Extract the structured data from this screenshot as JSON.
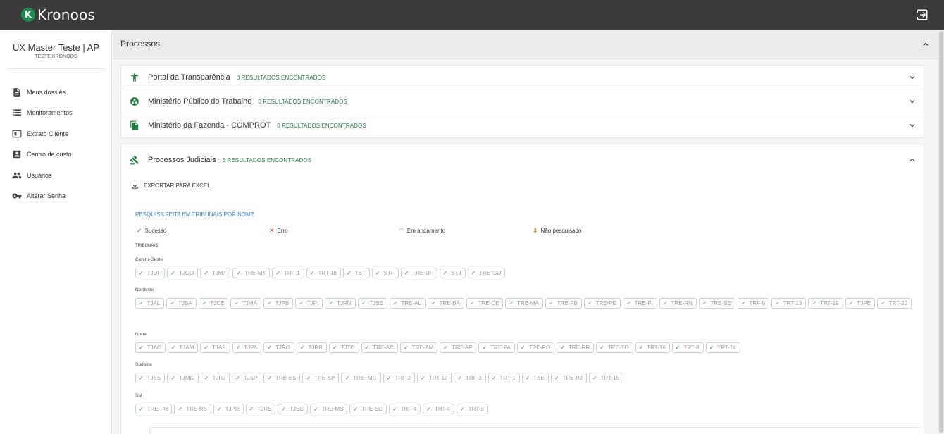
{
  "app": {
    "logo_letter": "K",
    "logo_text": "Kronoos",
    "brand_color": "#1c8a48"
  },
  "user": {
    "name": "UX Master Teste | AP",
    "subtitle": "TESTE KRONOOS"
  },
  "sidebar": {
    "items": [
      {
        "label": "Meus dossiês",
        "icon": "document-icon"
      },
      {
        "label": "Monitoramentos",
        "icon": "storage-icon"
      },
      {
        "label": "Extrato Cliente",
        "icon": "statement-icon"
      },
      {
        "label": "Centro de custo",
        "icon": "contact-card-icon"
      },
      {
        "label": "Usuários",
        "icon": "people-icon"
      },
      {
        "label": "Alterar Senha",
        "icon": "key-icon"
      }
    ]
  },
  "section": {
    "title": "Processos"
  },
  "panels": [
    {
      "name": "Portal da Transparência",
      "count": "0 RESULTADOS ENCONTRADOS",
      "icon": "accessibility-icon"
    },
    {
      "name": "Ministério Público do Trabalho",
      "count": "0 RESULTADOS ENCONTRADOS",
      "icon": "group-circle-icon"
    },
    {
      "name": "Ministério da Fazenda - COMPROT",
      "count": "0 RESULTADOS ENCONTRADOS",
      "icon": "copy-files-icon"
    }
  ],
  "judicial": {
    "name": "Processos Judiciais",
    "count": "5 RESULTADOS ENCONTRADOS",
    "icon": "gavel-icon",
    "export_label": "EXPORTAR PARA EXCEL",
    "search_label": "PESQUISA FEITA EM TRIBUNAIS POR NOME",
    "legend": {
      "success": "Sucesso",
      "error": "Erro",
      "pending": "Em andamento",
      "not_searched": "Não pesquisado"
    },
    "tribunais_label": "TRIBUNAIS:",
    "regions": [
      {
        "name": "Centro-Oeste",
        "courts": [
          "TJDF",
          "TJGO",
          "TJMT",
          "TRE-MT",
          "TRF-1",
          "TRT-18",
          "TST",
          "STF",
          "TRE-DF",
          "STJ",
          "TRE-GO"
        ]
      },
      {
        "name": "Nordeste",
        "courts": [
          "TJAL",
          "TJBA",
          "TJCE",
          "TJMA",
          "TJPB",
          "TJPI",
          "TJRN",
          "TJSE",
          "TRE-AL",
          "TRE-BA",
          "TRE-CE",
          "TRE-MA",
          "TRE-PB",
          "TRE-PE",
          "TRE-PI",
          "TRE-RN",
          "TRE-SE",
          "TRF-5",
          "TRT-13",
          "TRT-19",
          "TJPE",
          "TRT-20"
        ]
      },
      {
        "name": "Norte",
        "courts": [
          "TJAC",
          "TJAM",
          "TJAP",
          "TJPA",
          "TJRO",
          "TJRR",
          "TJTO",
          "TRE-AC",
          "TRE-AM",
          "TRE-AP",
          "TRE-PA",
          "TRE-RO",
          "TRE-RR",
          "TRE-TO",
          "TRT-16",
          "TRT-8",
          "TRT-14"
        ]
      },
      {
        "name": "Sudeste",
        "courts": [
          "TJES",
          "TJMG",
          "TJRJ",
          "TJSP",
          "TRE-ES",
          "TRE-SP",
          "TRE~MG",
          "TRF-2",
          "TRT-17",
          "TRF-3",
          "TRT-1",
          "TSE",
          "TRE-RJ",
          "TRT-15"
        ]
      },
      {
        "name": "Sul",
        "courts": [
          "TRE-PR",
          "TRE-RS",
          "TJPR",
          "TJRS",
          "TJSC",
          "TRE-MS",
          "TRE-SC",
          "TRF-4",
          "TRT-4",
          "TRT-9"
        ]
      }
    ]
  }
}
